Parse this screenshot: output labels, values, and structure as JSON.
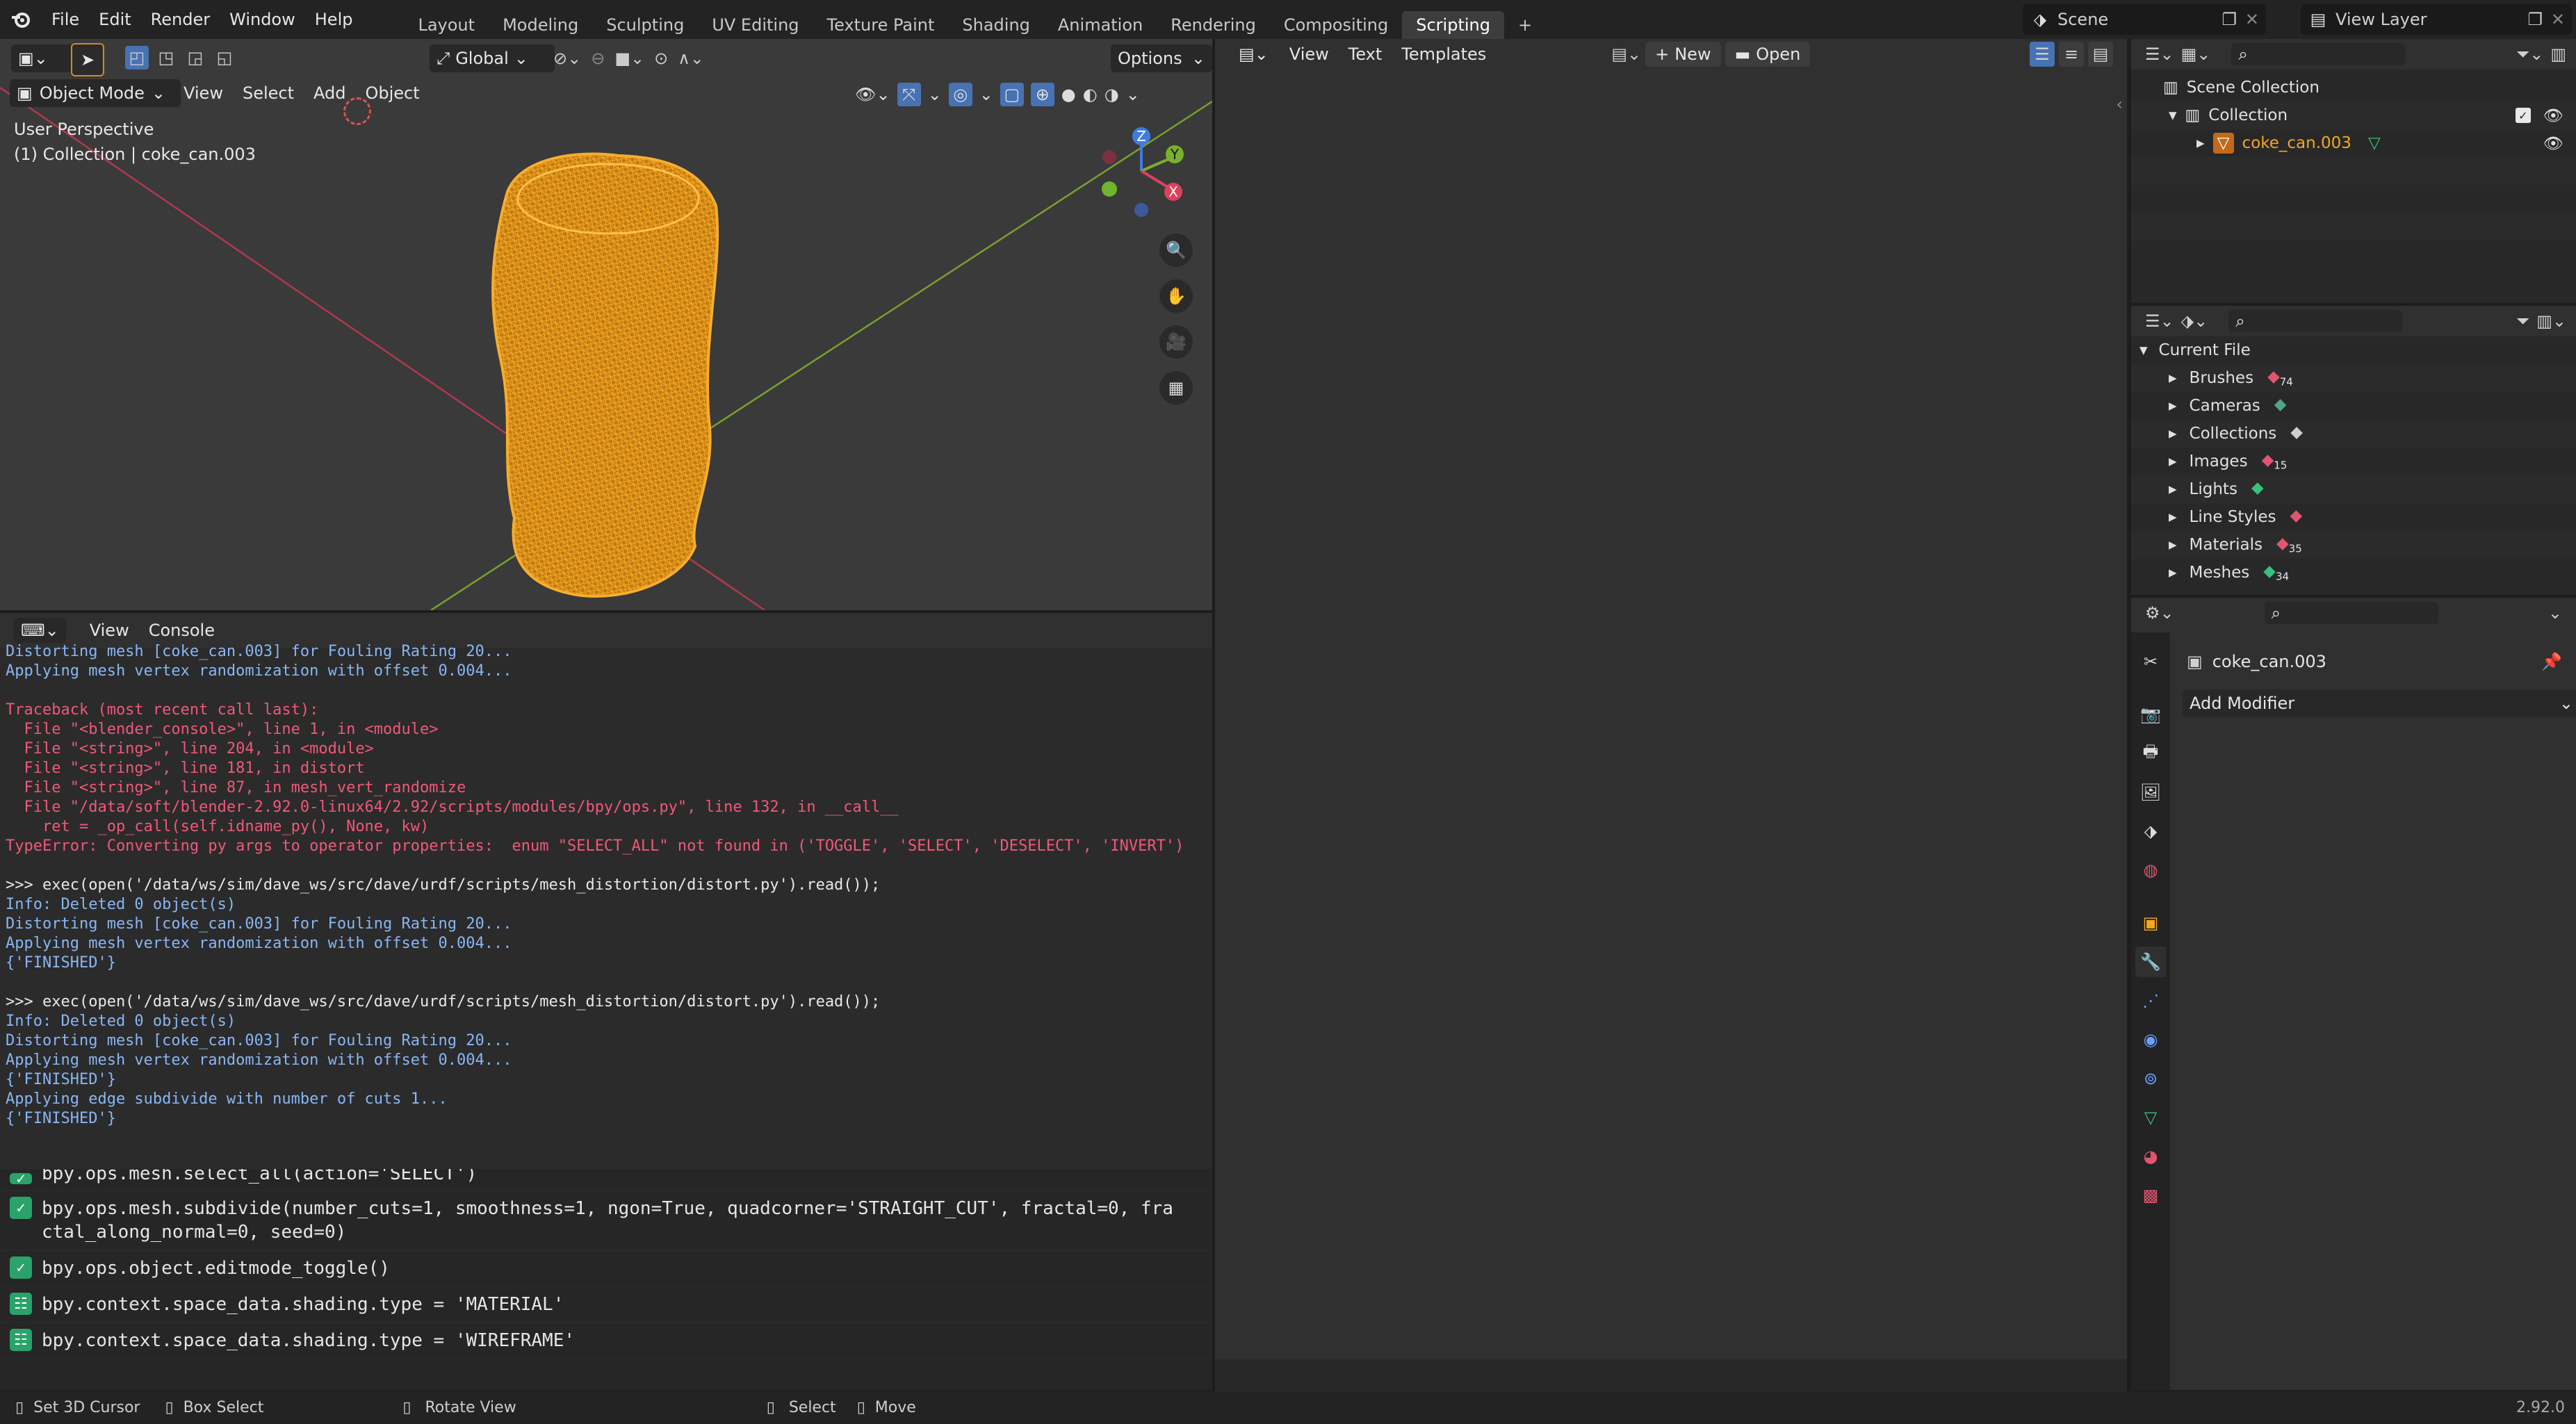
{
  "topbar": {
    "menus": [
      "File",
      "Edit",
      "Render",
      "Window",
      "Help"
    ],
    "workspaces": [
      "Layout",
      "Modeling",
      "Sculpting",
      "UV Editing",
      "Texture Paint",
      "Shading",
      "Animation",
      "Rendering",
      "Compositing",
      "Scripting"
    ],
    "active_workspace": "Scripting",
    "add_tab": "+",
    "scene": "Scene",
    "view_layer": "View Layer"
  },
  "viewport": {
    "mode": "Object Mode",
    "menus": [
      "View",
      "Select",
      "Add",
      "Object"
    ],
    "transform": "Global",
    "options": "Options",
    "perspective_label": "User Perspective",
    "collection_label": "(1) Collection | coke_can.003",
    "gizmo": {
      "z": "Z",
      "y": "Y",
      "x": "X"
    }
  },
  "text_editor": {
    "menus": [
      "View",
      "Text",
      "Templates"
    ],
    "new_label": "New",
    "open_label": "Open"
  },
  "console": {
    "menus": [
      "View",
      "Console"
    ],
    "lines": [
      {
        "text": "Distorting mesh [coke_can.003] for Fouling Rating 20...",
        "kind": "blue"
      },
      {
        "text": "Applying mesh vertex randomization with offset 0.004...",
        "kind": "blue"
      },
      {
        "text": "",
        "kind": "blue"
      },
      {
        "text": "Traceback (most recent call last):",
        "kind": "red"
      },
      {
        "text": "  File \"<blender_console>\", line 1, in <module>",
        "kind": "red"
      },
      {
        "text": "  File \"<string>\", line 204, in <module>",
        "kind": "red"
      },
      {
        "text": "  File \"<string>\", line 181, in distort",
        "kind": "red"
      },
      {
        "text": "  File \"<string>\", line 87, in mesh_vert_randomize",
        "kind": "red"
      },
      {
        "text": "  File \"/data/soft/blender-2.92.0-linux64/2.92/scripts/modules/bpy/ops.py\", line 132, in __call__",
        "kind": "red"
      },
      {
        "text": "    ret = _op_call(self.idname_py(), None, kw)",
        "kind": "red"
      },
      {
        "text": "TypeError: Converting py args to operator properties:  enum \"SELECT_ALL\" not found in ('TOGGLE', 'SELECT', 'DESELECT', 'INVERT')",
        "kind": "red"
      },
      {
        "text": "",
        "kind": "blue"
      },
      {
        "text": ">>> exec(open('/data/ws/sim/dave_ws/src/dave/urdf/scripts/mesh_distortion/distort.py').read());",
        "kind": "white"
      },
      {
        "text": "Info: Deleted 0 object(s)",
        "kind": "blue"
      },
      {
        "text": "Distorting mesh [coke_can.003] for Fouling Rating 20...",
        "kind": "blue"
      },
      {
        "text": "Applying mesh vertex randomization with offset 0.004...",
        "kind": "blue"
      },
      {
        "text": "{'FINISHED'}",
        "kind": "blue"
      },
      {
        "text": "",
        "kind": "blue"
      },
      {
        "text": ">>> exec(open('/data/ws/sim/dave_ws/src/dave/urdf/scripts/mesh_distortion/distort.py').read());",
        "kind": "white"
      },
      {
        "text": "Info: Deleted 0 object(s)",
        "kind": "blue"
      },
      {
        "text": "Distorting mesh [coke_can.003] for Fouling Rating 20...",
        "kind": "blue"
      },
      {
        "text": "Applying mesh vertex randomization with offset 0.004...",
        "kind": "blue"
      },
      {
        "text": "{'FINISHED'}",
        "kind": "blue"
      },
      {
        "text": "Applying edge subdivide with number of cuts 1...",
        "kind": "blue"
      },
      {
        "text": "{'FINISHED'}",
        "kind": "blue"
      },
      {
        "text": "",
        "kind": "blue"
      }
    ],
    "prompt": ">>> "
  },
  "info_log": {
    "partial": "bpy.ops.mesh.select_all(action='SELECT')",
    "rows": [
      {
        "text": "bpy.ops.mesh.subdivide(number_cuts=1, smoothness=1, ngon=True, quadcorner='STRAIGHT_CUT', fractal=0, fra",
        "text2": "ctal_along_normal=0, seed=0)",
        "icon": "check"
      },
      {
        "text": "bpy.ops.object.editmode_toggle()",
        "text2": "",
        "icon": "check"
      },
      {
        "text": "bpy.context.space_data.shading.type = 'MATERIAL'",
        "text2": "",
        "icon": "property"
      },
      {
        "text": "bpy.context.space_data.shading.type = 'WIREFRAME'",
        "text2": "",
        "icon": "property"
      }
    ]
  },
  "outliner": {
    "scene_collection": "Scene Collection",
    "collection": "Collection",
    "object": "coke_can.003"
  },
  "blend_file": {
    "current_file": "Current File",
    "items": [
      {
        "label": "Brushes",
        "count": "74",
        "color": "#e0556f"
      },
      {
        "label": "Cameras",
        "count": "",
        "color": "#4fa58e"
      },
      {
        "label": "Collections",
        "count": "",
        "color": "#cfcfcf"
      },
      {
        "label": "Images",
        "count": "15",
        "color": "#e0556f"
      },
      {
        "label": "Lights",
        "count": "",
        "color": "#36c17c"
      },
      {
        "label": "Line Styles",
        "count": "",
        "color": "#e0556f"
      },
      {
        "label": "Materials",
        "count": "35",
        "color": "#e0556f"
      },
      {
        "label": "Meshes",
        "count": "34",
        "color": "#36c17c"
      }
    ]
  },
  "properties": {
    "object_name": "coke_can.003",
    "add_modifier": "Add Modifier"
  },
  "statusbar": {
    "set_cursor": "Set 3D Cursor",
    "box_select": "Box Select",
    "rotate_view": "Rotate View",
    "select": "Select",
    "move": "Move",
    "version": "2.92.0"
  },
  "colors": {
    "accent": "#4772b3",
    "orange": "#f5a623",
    "mesh": "#f0a020"
  }
}
